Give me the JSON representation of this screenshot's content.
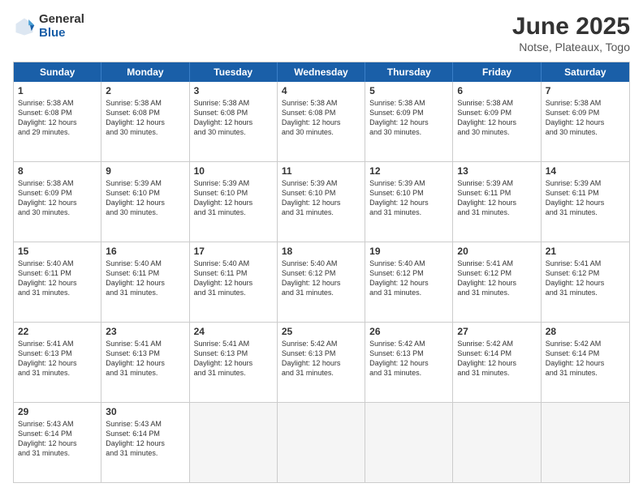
{
  "logo": {
    "general": "General",
    "blue": "Blue"
  },
  "title": "June 2025",
  "subtitle": "Notse, Plateaux, Togo",
  "weekdays": [
    "Sunday",
    "Monday",
    "Tuesday",
    "Wednesday",
    "Thursday",
    "Friday",
    "Saturday"
  ],
  "rows": [
    [
      {
        "day": "1",
        "lines": [
          "Sunrise: 5:38 AM",
          "Sunset: 6:08 PM",
          "Daylight: 12 hours",
          "and 29 minutes."
        ]
      },
      {
        "day": "2",
        "lines": [
          "Sunrise: 5:38 AM",
          "Sunset: 6:08 PM",
          "Daylight: 12 hours",
          "and 30 minutes."
        ]
      },
      {
        "day": "3",
        "lines": [
          "Sunrise: 5:38 AM",
          "Sunset: 6:08 PM",
          "Daylight: 12 hours",
          "and 30 minutes."
        ]
      },
      {
        "day": "4",
        "lines": [
          "Sunrise: 5:38 AM",
          "Sunset: 6:08 PM",
          "Daylight: 12 hours",
          "and 30 minutes."
        ]
      },
      {
        "day": "5",
        "lines": [
          "Sunrise: 5:38 AM",
          "Sunset: 6:09 PM",
          "Daylight: 12 hours",
          "and 30 minutes."
        ]
      },
      {
        "day": "6",
        "lines": [
          "Sunrise: 5:38 AM",
          "Sunset: 6:09 PM",
          "Daylight: 12 hours",
          "and 30 minutes."
        ]
      },
      {
        "day": "7",
        "lines": [
          "Sunrise: 5:38 AM",
          "Sunset: 6:09 PM",
          "Daylight: 12 hours",
          "and 30 minutes."
        ]
      }
    ],
    [
      {
        "day": "8",
        "lines": [
          "Sunrise: 5:38 AM",
          "Sunset: 6:09 PM",
          "Daylight: 12 hours",
          "and 30 minutes."
        ]
      },
      {
        "day": "9",
        "lines": [
          "Sunrise: 5:39 AM",
          "Sunset: 6:10 PM",
          "Daylight: 12 hours",
          "and 30 minutes."
        ]
      },
      {
        "day": "10",
        "lines": [
          "Sunrise: 5:39 AM",
          "Sunset: 6:10 PM",
          "Daylight: 12 hours",
          "and 31 minutes."
        ]
      },
      {
        "day": "11",
        "lines": [
          "Sunrise: 5:39 AM",
          "Sunset: 6:10 PM",
          "Daylight: 12 hours",
          "and 31 minutes."
        ]
      },
      {
        "day": "12",
        "lines": [
          "Sunrise: 5:39 AM",
          "Sunset: 6:10 PM",
          "Daylight: 12 hours",
          "and 31 minutes."
        ]
      },
      {
        "day": "13",
        "lines": [
          "Sunrise: 5:39 AM",
          "Sunset: 6:11 PM",
          "Daylight: 12 hours",
          "and 31 minutes."
        ]
      },
      {
        "day": "14",
        "lines": [
          "Sunrise: 5:39 AM",
          "Sunset: 6:11 PM",
          "Daylight: 12 hours",
          "and 31 minutes."
        ]
      }
    ],
    [
      {
        "day": "15",
        "lines": [
          "Sunrise: 5:40 AM",
          "Sunset: 6:11 PM",
          "Daylight: 12 hours",
          "and 31 minutes."
        ]
      },
      {
        "day": "16",
        "lines": [
          "Sunrise: 5:40 AM",
          "Sunset: 6:11 PM",
          "Daylight: 12 hours",
          "and 31 minutes."
        ]
      },
      {
        "day": "17",
        "lines": [
          "Sunrise: 5:40 AM",
          "Sunset: 6:11 PM",
          "Daylight: 12 hours",
          "and 31 minutes."
        ]
      },
      {
        "day": "18",
        "lines": [
          "Sunrise: 5:40 AM",
          "Sunset: 6:12 PM",
          "Daylight: 12 hours",
          "and 31 minutes."
        ]
      },
      {
        "day": "19",
        "lines": [
          "Sunrise: 5:40 AM",
          "Sunset: 6:12 PM",
          "Daylight: 12 hours",
          "and 31 minutes."
        ]
      },
      {
        "day": "20",
        "lines": [
          "Sunrise: 5:41 AM",
          "Sunset: 6:12 PM",
          "Daylight: 12 hours",
          "and 31 minutes."
        ]
      },
      {
        "day": "21",
        "lines": [
          "Sunrise: 5:41 AM",
          "Sunset: 6:12 PM",
          "Daylight: 12 hours",
          "and 31 minutes."
        ]
      }
    ],
    [
      {
        "day": "22",
        "lines": [
          "Sunrise: 5:41 AM",
          "Sunset: 6:13 PM",
          "Daylight: 12 hours",
          "and 31 minutes."
        ]
      },
      {
        "day": "23",
        "lines": [
          "Sunrise: 5:41 AM",
          "Sunset: 6:13 PM",
          "Daylight: 12 hours",
          "and 31 minutes."
        ]
      },
      {
        "day": "24",
        "lines": [
          "Sunrise: 5:41 AM",
          "Sunset: 6:13 PM",
          "Daylight: 12 hours",
          "and 31 minutes."
        ]
      },
      {
        "day": "25",
        "lines": [
          "Sunrise: 5:42 AM",
          "Sunset: 6:13 PM",
          "Daylight: 12 hours",
          "and 31 minutes."
        ]
      },
      {
        "day": "26",
        "lines": [
          "Sunrise: 5:42 AM",
          "Sunset: 6:13 PM",
          "Daylight: 12 hours",
          "and 31 minutes."
        ]
      },
      {
        "day": "27",
        "lines": [
          "Sunrise: 5:42 AM",
          "Sunset: 6:14 PM",
          "Daylight: 12 hours",
          "and 31 minutes."
        ]
      },
      {
        "day": "28",
        "lines": [
          "Sunrise: 5:42 AM",
          "Sunset: 6:14 PM",
          "Daylight: 12 hours",
          "and 31 minutes."
        ]
      }
    ],
    [
      {
        "day": "29",
        "lines": [
          "Sunrise: 5:43 AM",
          "Sunset: 6:14 PM",
          "Daylight: 12 hours",
          "and 31 minutes."
        ]
      },
      {
        "day": "30",
        "lines": [
          "Sunrise: 5:43 AM",
          "Sunset: 6:14 PM",
          "Daylight: 12 hours",
          "and 31 minutes."
        ]
      },
      {
        "day": "",
        "lines": []
      },
      {
        "day": "",
        "lines": []
      },
      {
        "day": "",
        "lines": []
      },
      {
        "day": "",
        "lines": []
      },
      {
        "day": "",
        "lines": []
      }
    ]
  ]
}
